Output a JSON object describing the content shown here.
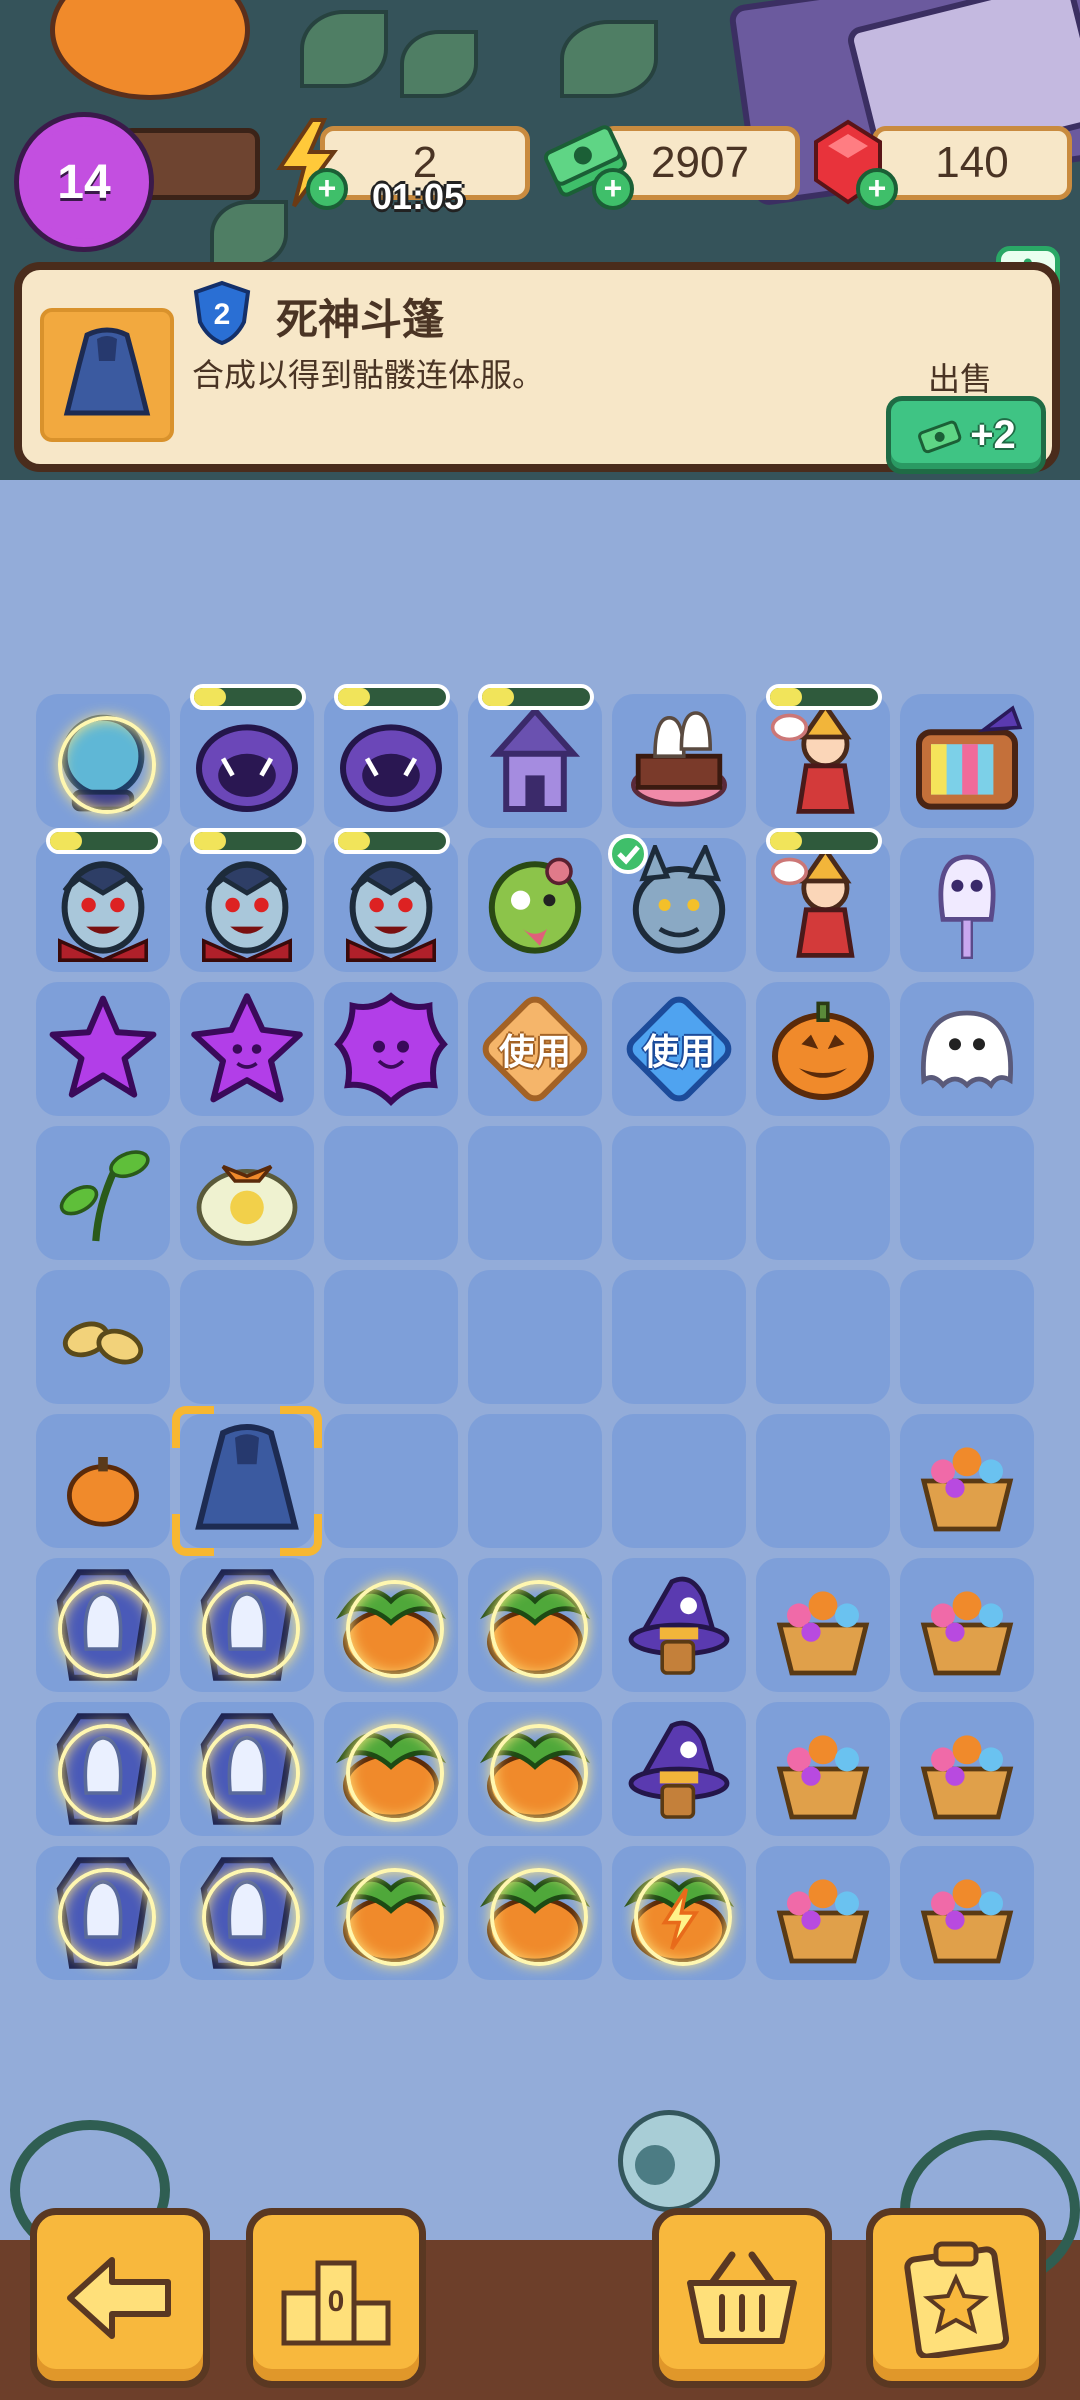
{
  "hud": {
    "level": "14",
    "energy": "2",
    "energy_timer": "01:05",
    "cash": "2907",
    "gems": "140",
    "plus_glyph": "+"
  },
  "info_panel": {
    "item_level": "2",
    "item_name": "死神斗篷",
    "description": "合成以得到骷髅连体服。",
    "sell_label": "出售",
    "sell_value": "+2",
    "info_glyph": "i"
  },
  "board": {
    "rows": 9,
    "cols": 7,
    "cells": [
      [
        {
          "icon": "crystal-ball-icon",
          "glow": true
        },
        {
          "icon": "purple-monster-plant-icon",
          "progress": 0.3
        },
        {
          "icon": "purple-monster-plant-icon",
          "progress": 0.3
        },
        {
          "icon": "haunted-house-icon",
          "progress": 0.3
        },
        {
          "icon": "ghost-cake-icon"
        },
        {
          "icon": "witch-girl-icon",
          "progress": 0.3
        },
        {
          "icon": "retro-tv-icon"
        }
      ],
      [
        {
          "icon": "vampire-icon",
          "progress": 0.3
        },
        {
          "icon": "vampire-icon",
          "progress": 0.3
        },
        {
          "icon": "vampire-icon",
          "progress": 0.3
        },
        {
          "icon": "zombie-head-icon"
        },
        {
          "icon": "werewolf-icon",
          "check": true
        },
        {
          "icon": "witch-girl-icon",
          "progress": 0.3
        },
        {
          "icon": "ghost-lollipop-icon"
        }
      ],
      [
        {
          "icon": "purple-star-icon"
        },
        {
          "icon": "purple-star-face-icon"
        },
        {
          "icon": "purple-blob-face-icon"
        },
        {
          "icon": "use-orange-token-icon",
          "text": "使用"
        },
        {
          "icon": "use-blue-token-icon",
          "text": "使用"
        },
        {
          "icon": "jack-o-lantern-icon"
        },
        {
          "icon": "ghost-icon"
        }
      ],
      [
        {
          "icon": "sprout-icon"
        },
        {
          "icon": "gift-bag-icon"
        },
        {},
        {},
        {},
        {},
        {}
      ],
      [
        {
          "icon": "seeds-icon"
        },
        {},
        {},
        {},
        {},
        {},
        {}
      ],
      [
        {
          "icon": "small-pumpkin-icon"
        },
        {
          "icon": "reaper-cloak-icon",
          "selected": true
        },
        {},
        {},
        {},
        {},
        {
          "icon": "flower-basket-icon"
        }
      ],
      [
        {
          "icon": "ghost-coffin-icon",
          "glow": true
        },
        {
          "icon": "ghost-coffin-icon",
          "glow": true
        },
        {
          "icon": "pumpkin-patch-icon",
          "glow": true
        },
        {
          "icon": "pumpkin-patch-icon",
          "glow": true
        },
        {
          "icon": "witch-hat-icon"
        },
        {
          "icon": "flower-basket-icon"
        },
        {
          "icon": "flower-basket-icon"
        }
      ],
      [
        {
          "icon": "ghost-coffin-icon",
          "glow": true
        },
        {
          "icon": "ghost-coffin-icon",
          "glow": true
        },
        {
          "icon": "pumpkin-patch-icon",
          "glow": true
        },
        {
          "icon": "pumpkin-patch-icon",
          "glow": true
        },
        {
          "icon": "witch-hat-icon"
        },
        {
          "icon": "flower-basket-icon"
        },
        {
          "icon": "flower-basket-icon"
        }
      ],
      [
        {
          "icon": "ghost-coffin-icon",
          "glow": true
        },
        {
          "icon": "ghost-coffin-icon",
          "glow": true
        },
        {
          "icon": "pumpkin-patch-icon",
          "glow": true
        },
        {
          "icon": "pumpkin-patch-icon",
          "glow": true
        },
        {
          "icon": "pumpkin-patch-energy-icon",
          "glow": true
        },
        {
          "icon": "flower-basket-icon"
        },
        {
          "icon": "flower-basket-icon"
        }
      ]
    ]
  },
  "nav": [
    {
      "name": "back-button",
      "icon": "arrow-left-icon"
    },
    {
      "name": "leaderboard-button",
      "icon": "podium-icon",
      "label": "0"
    },
    {
      "name": "shop-button",
      "icon": "basket-icon"
    },
    {
      "name": "tasks-button",
      "icon": "clipboard-star-icon"
    }
  ],
  "colors": {
    "board_bg": "#93acd9",
    "cell_bg": "#7e9fd9",
    "panel_bg": "#f7e7c8",
    "sell_green": "#3fc484",
    "nav_orange": "#f8b83d"
  }
}
